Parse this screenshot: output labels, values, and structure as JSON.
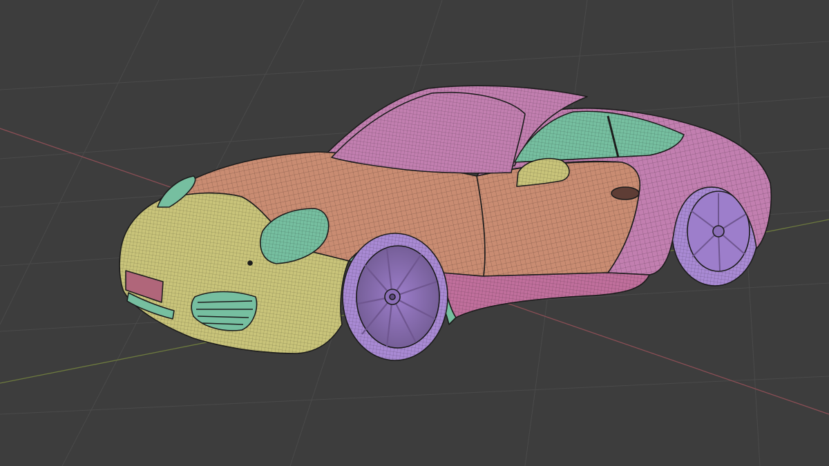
{
  "viewport": {
    "background_color": "#3d3d3d",
    "grid_color": "#4a4a4a",
    "x_axis_color": "#8a4e55",
    "y_axis_color": "#6d7a3e"
  },
  "model": {
    "shading": "wireframe-overlay",
    "face_sets": [
      {
        "part": "hood-front-fender",
        "color": "#c98c72"
      },
      {
        "part": "roof-rear-quarter",
        "color": "#c27fb0"
      },
      {
        "part": "front-bumper",
        "color": "#c9c47a"
      },
      {
        "part": "windows-headlights",
        "color": "#76bfa0"
      },
      {
        "part": "wheels",
        "color": "#a98ad4"
      },
      {
        "part": "side-skirt",
        "color": "#c06f9c"
      }
    ]
  }
}
